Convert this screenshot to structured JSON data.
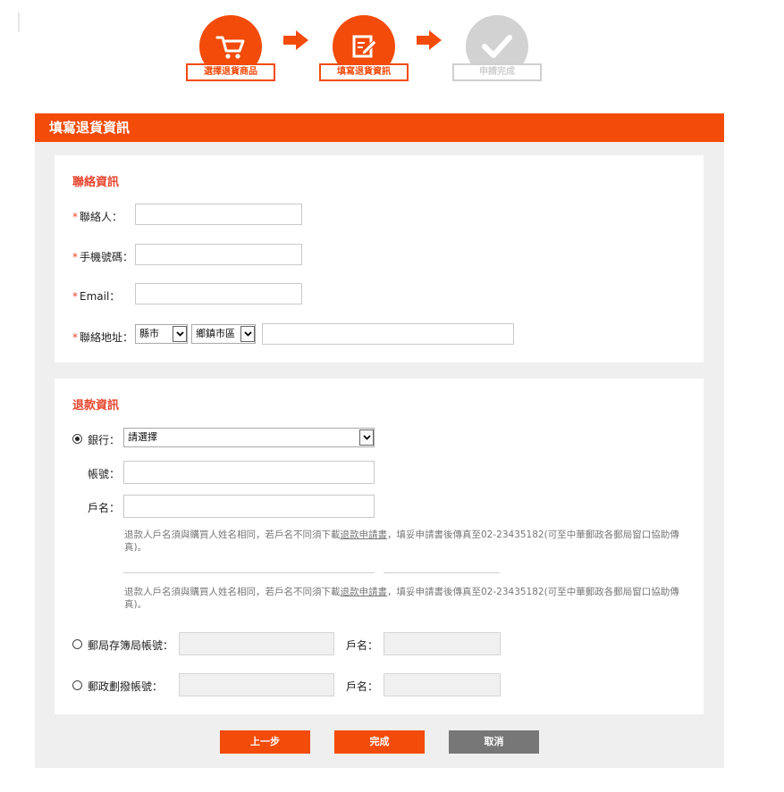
{
  "steps": [
    {
      "label": "選擇退貨商品",
      "state": "active",
      "icon": "cart-icon"
    },
    {
      "label": "填寫退貨資訊",
      "state": "active",
      "icon": "edit-form-icon"
    },
    {
      "label": "申請完成",
      "state": "inactive",
      "icon": "checkmark-icon"
    }
  ],
  "page_title": "填寫退貨資訊",
  "contact": {
    "title": "聯絡資訊",
    "required_mark": "*",
    "name_label": "聯絡人：",
    "phone_label": "手機號碼：",
    "email_label": "Email：",
    "address_label": "聯絡地址：",
    "county_value": "縣市",
    "district_value": "鄉鎮市區",
    "name_value": "",
    "phone_value": "",
    "email_value": "",
    "address_value": ""
  },
  "refund": {
    "title": "退款資訊",
    "bank_label": "銀行：",
    "bank_value": "請選擇",
    "account_label": "帳號：",
    "holder_label": "戶名：",
    "note_prefix": "退款人戶名須與購買人姓名相同，若戶名不同須下載",
    "note_link": "退款申請書",
    "note_suffix": "，填妥申請書後傳真至02-23435182(可至中華郵政各郵局窗口協助傳真)。",
    "post_savings_label": "郵局存簿局帳號：",
    "post_savings_holder_label": "戶名：",
    "postal_transfer_label": "郵政劃撥帳號：",
    "postal_transfer_holder_label": "戶名：",
    "selected_method": "bank"
  },
  "buttons": {
    "prev": "上一步",
    "finish": "完成",
    "cancel": "取消"
  },
  "colors": {
    "accent": "#f24b0a",
    "required": "#e8462e",
    "inactive": "#d2d2d2",
    "cancel": "#777777"
  }
}
